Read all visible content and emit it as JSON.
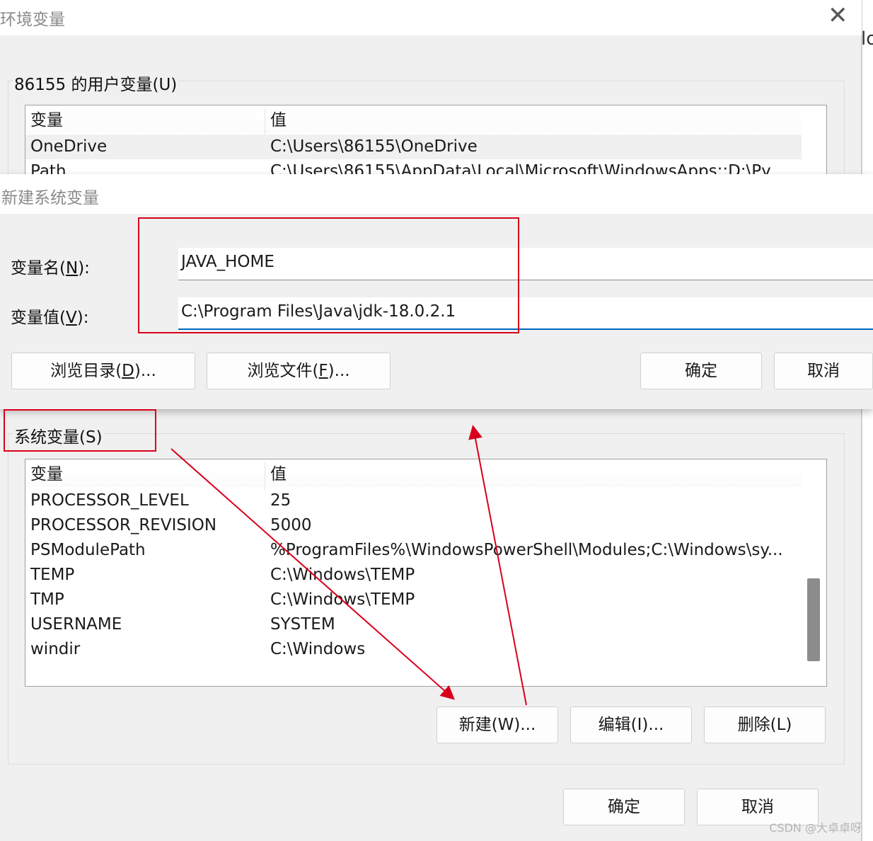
{
  "env_window": {
    "title": "环境变量",
    "close_glyph": "✕",
    "user_vars_label": "86155 的用户变量(U)",
    "user_vars": {
      "headers": [
        "变量",
        "值"
      ],
      "rows": [
        [
          "OneDrive",
          "C:\\Users\\86155\\OneDrive"
        ],
        [
          "Path",
          "C:\\Users\\86155\\AppData\\Local\\Microsoft\\WindowsApps;;D:\\Py..."
        ]
      ]
    },
    "system_vars_label": "系统变量(S)",
    "system_vars": {
      "headers": [
        "变量",
        "值"
      ],
      "rows": [
        [
          "PROCESSOR_LEVEL",
          "25"
        ],
        [
          "PROCESSOR_REVISION",
          "5000"
        ],
        [
          "PSModulePath",
          "%ProgramFiles%\\WindowsPowerShell\\Modules;C:\\Windows\\sy..."
        ],
        [
          "TEMP",
          "C:\\Windows\\TEMP"
        ],
        [
          "TMP",
          "C:\\Windows\\TEMP"
        ],
        [
          "USERNAME",
          "SYSTEM"
        ],
        [
          "windir",
          "C:\\Windows"
        ]
      ]
    },
    "buttons": {
      "new": "新建(W)...",
      "edit": "编辑(I)...",
      "delete": "删除(L)",
      "ok": "确定",
      "cancel": "取消"
    }
  },
  "new_dialog": {
    "title": "新建系统变量",
    "name_label_pre": "变量名(",
    "name_label_key": "N",
    "name_label_post": "):",
    "name_value": "JAVA_HOME",
    "value_label_pre": "变量值(",
    "value_label_key": "V",
    "value_label_post": "):",
    "value_value": "C:\\Program Files\\Java\\jdk-18.0.2.1",
    "browse_dir_pre": "浏览目录(",
    "browse_dir_key": "D",
    "browse_dir_post": ")...",
    "browse_file_pre": "浏览文件(",
    "browse_file_key": "F",
    "browse_file_post": ")...",
    "ok": "确定",
    "cancel": "取消"
  },
  "background_app_fragment": "lo",
  "watermark": "CSDN @大卓卓呀",
  "annotation_color": "#d9001b",
  "accent_color": "#0067c0"
}
